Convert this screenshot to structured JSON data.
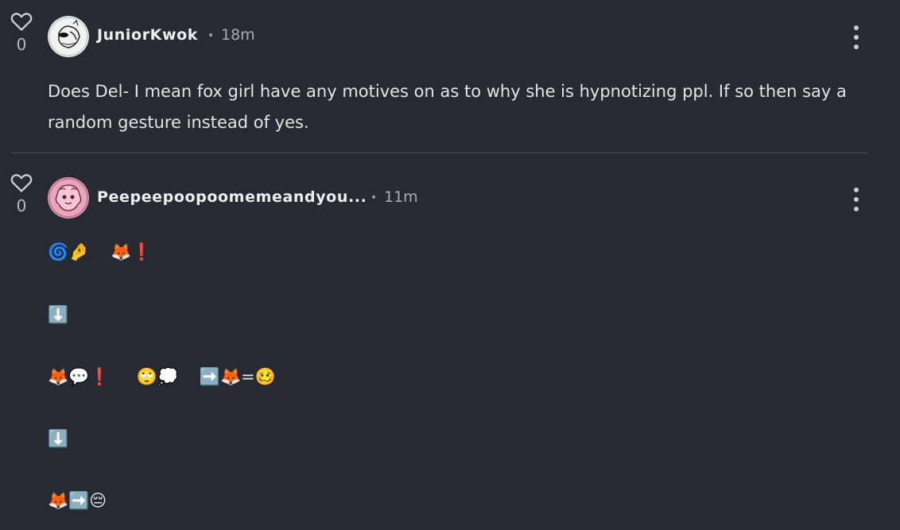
{
  "posts": [
    {
      "likes": "0",
      "author": "JuniorKwok",
      "dot": "•",
      "time": "18m",
      "text": "Does Del- I mean fox girl have any motives on as to why she is hypnotizing ppl. If so then say a random gesture instead of yes."
    },
    {
      "likes": "0",
      "author": "Peepeepoopoomemeandyou...",
      "dot": "•",
      "time": "11m",
      "lines": [
        "🌀🤌    🦊❗",
        "⬇️",
        "🦊💬❗     🙄💭    ➡️🦊=🥴",
        "⬇️",
        "🦊➡️😔"
      ]
    }
  ]
}
